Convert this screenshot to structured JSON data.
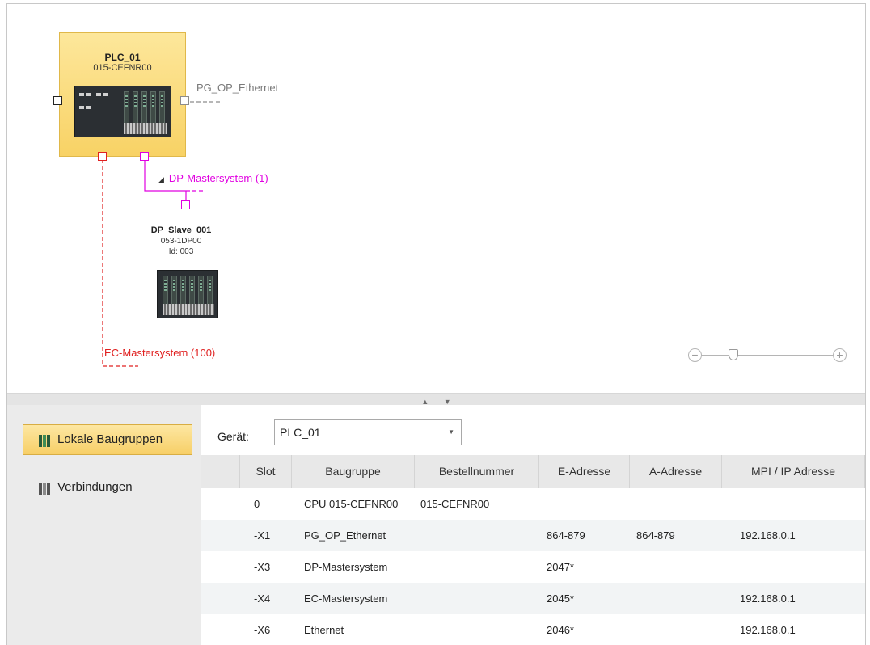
{
  "canvas": {
    "plc": {
      "name": "PLC_01",
      "order": "015-CEFNR00"
    },
    "slave": {
      "name": "DP_Slave_001",
      "order": "053-1DP00",
      "id": "Id: 003"
    },
    "networks": {
      "ethernet": "PG_OP_Ethernet",
      "dp": "DP-Mastersystem (1)",
      "ec": "EC-Mastersystem (100)"
    },
    "colors": {
      "dp": "#e100e1",
      "ec": "#e02020",
      "ethernet": "#8c8c8c",
      "device_fill": "#f8d265"
    },
    "zoom": {
      "out_icon": "−",
      "in_icon": "+"
    }
  },
  "splitter": {
    "up_icon": "▲",
    "down_icon": "▼"
  },
  "sidebar": {
    "items": [
      {
        "label": "Lokale Baugruppen",
        "icon": "local-modules-icon",
        "active": true
      },
      {
        "label": "Verbindungen",
        "icon": "connections-icon",
        "active": false
      }
    ]
  },
  "device_select": {
    "label": "Gerät:",
    "value": "PLC_01"
  },
  "table": {
    "headers": [
      "Slot",
      "Baugruppe",
      "Bestellnummer",
      "E-Adresse",
      "A-Adresse",
      "MPI / IP Adresse"
    ],
    "rows": [
      [
        "0",
        "CPU 015-CEFNR00",
        "015-CEFNR00",
        "",
        "",
        ""
      ],
      [
        "-X1",
        "PG_OP_Ethernet",
        "",
        "864-879",
        "864-879",
        "192.168.0.1"
      ],
      [
        "-X3",
        "DP-Mastersystem",
        "",
        "2047*",
        "",
        ""
      ],
      [
        "-X4",
        "EC-Mastersystem",
        "",
        "2045*",
        "",
        "192.168.0.1"
      ],
      [
        "-X6",
        "Ethernet",
        "",
        "2046*",
        "",
        "192.168.0.1"
      ]
    ]
  }
}
